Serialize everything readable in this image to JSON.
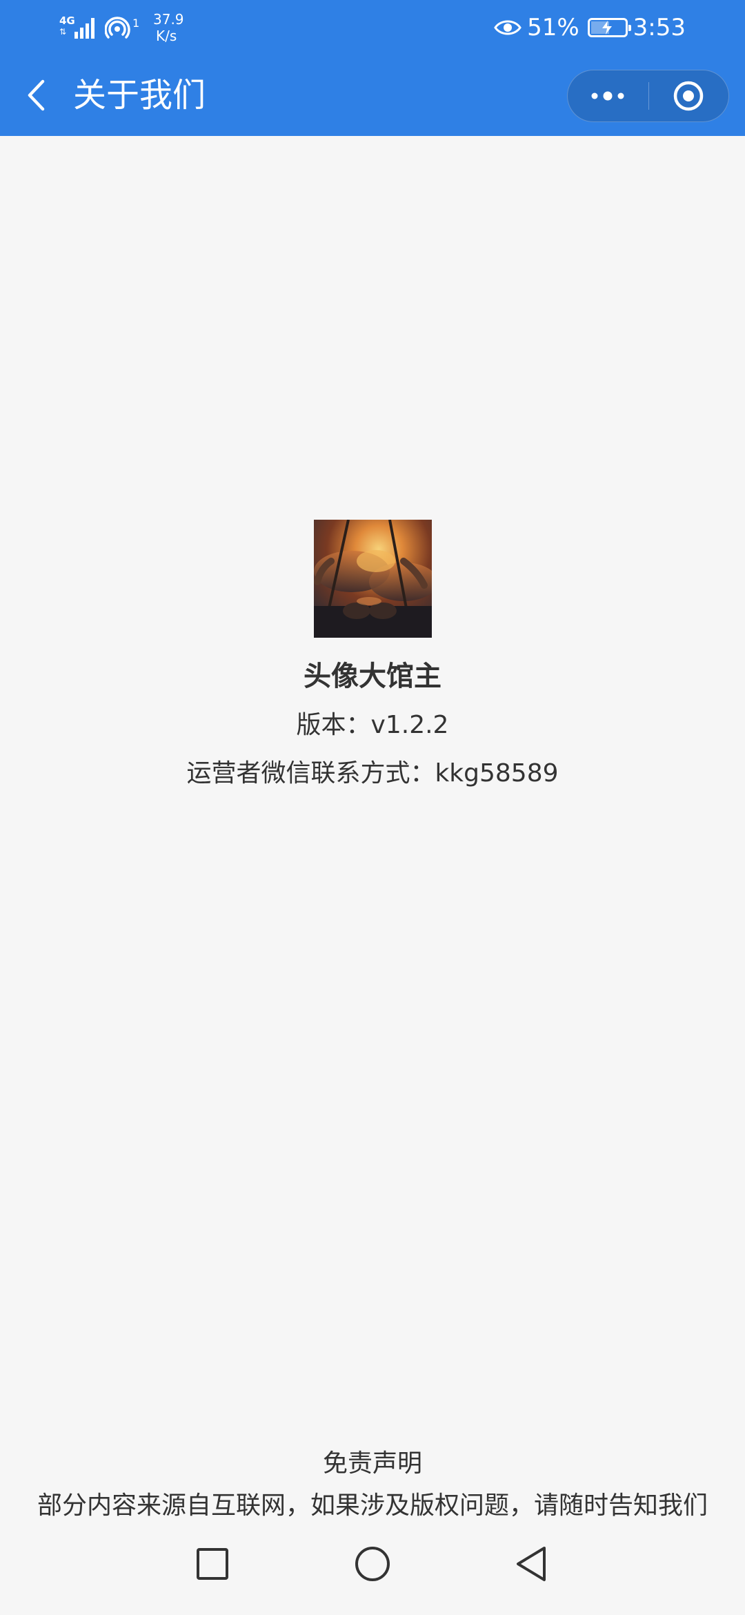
{
  "status_bar": {
    "network": "4G",
    "wifi_sup": "1",
    "speed_value": "37.9",
    "speed_unit": "K/s",
    "battery": "51%",
    "time": "3:53"
  },
  "nav": {
    "title": "关于我们"
  },
  "app": {
    "name": "头像大馆主",
    "version": "版本：v1.2.2",
    "contact": "运营者微信联系方式：kkg58589"
  },
  "disclaimer": {
    "title": "免责声明",
    "text": "部分内容来源自互联网，如果涉及版权问题，请随时告知我们"
  },
  "icons": {
    "back": "back-icon",
    "more": "more-icon",
    "close": "close-mini-program-icon",
    "recent": "recent-apps-icon",
    "home": "home-icon",
    "sys_back": "system-back-icon"
  },
  "colors": {
    "header": "#2f80e5",
    "background": "#f6f6f6",
    "text": "#333333"
  }
}
